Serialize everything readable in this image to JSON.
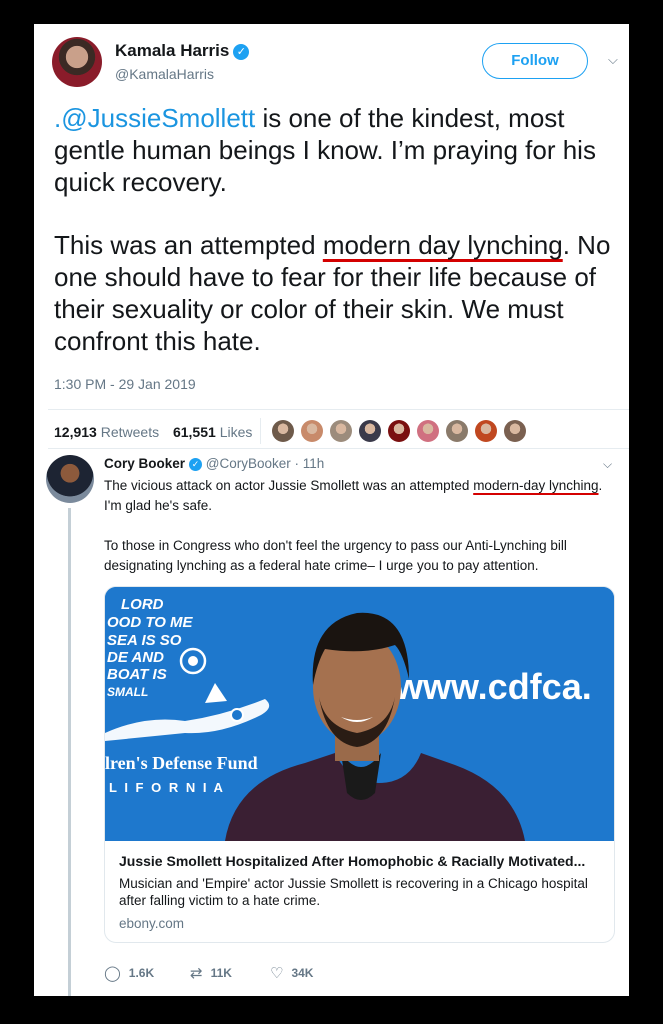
{
  "main_tweet": {
    "author_name": "Kamala Harris",
    "author_handle": "@KamalaHarris",
    "follow_label": "Follow",
    "mention": ".@JussieSmollett",
    "text_p1_rest": " is one of the kindest, most gentle human beings I know. I’m praying for his quick recovery.",
    "text_p2_before": "This was an attempted ",
    "text_p2_underlined": "modern day lynching",
    "text_p2_after": ". No one should have to fear for their life because of their sexuality or color of their skin. We must confront this hate.",
    "timestamp": "1:30 PM - 29 Jan 2019",
    "retweets_count": "12,913",
    "retweets_label": "Retweets",
    "likes_count": "61,551",
    "likes_label": "Likes",
    "liker_avatar_colors": [
      "#6e5a4a",
      "#c88a6a",
      "#9c8c7c",
      "#3a3a4a",
      "#7a1010",
      "#d07080",
      "#8a7a6a",
      "#c04820",
      "#7a6050"
    ]
  },
  "reply": {
    "author_name": "Cory Booker",
    "author_handle": "@CoryBooker",
    "time": "11h",
    "text_p1_before": "The vicious attack on actor Jussie Smollett was an attempted ",
    "text_p1_underlined": "modern-day lynching",
    "text_p1_after": ". I'm glad he's safe.",
    "text_p2": "To those in Congress who don't feel the urgency to pass our Anti-Lynching bill designating lynching as a federal hate crime– I urge you to pay attention.",
    "link_card": {
      "image_text_lines": [
        "LORD",
        "OOD TO ME",
        "SEA IS SO",
        "DE AND",
        "BOAT IS",
        "SMALL"
      ],
      "image_url_text": "www.cdfca.",
      "image_org_text": "lren's Defense Fund",
      "image_state_text": "L I F O R N I A",
      "title": "Jussie Smollett Hospitalized After Homophobic & Racially Motivated...",
      "description": "Musician and 'Empire' actor Jussie Smollett is recovering in a Chicago hospital after falling victim to a hate crime.",
      "domain": "ebony.com"
    },
    "actions": {
      "replies": "1.6K",
      "retweets": "11K",
      "likes": "34K"
    }
  },
  "colors": {
    "accent_blue": "#1da1f2",
    "mention_blue": "#1b95e0",
    "annotation_red": "#d40000",
    "muted_gray": "#657786",
    "card_image_bg": "#1e78cd"
  },
  "icons": [
    "verified-badge-icon",
    "chevron-down-icon",
    "reply-icon",
    "retweet-icon",
    "like-icon"
  ]
}
